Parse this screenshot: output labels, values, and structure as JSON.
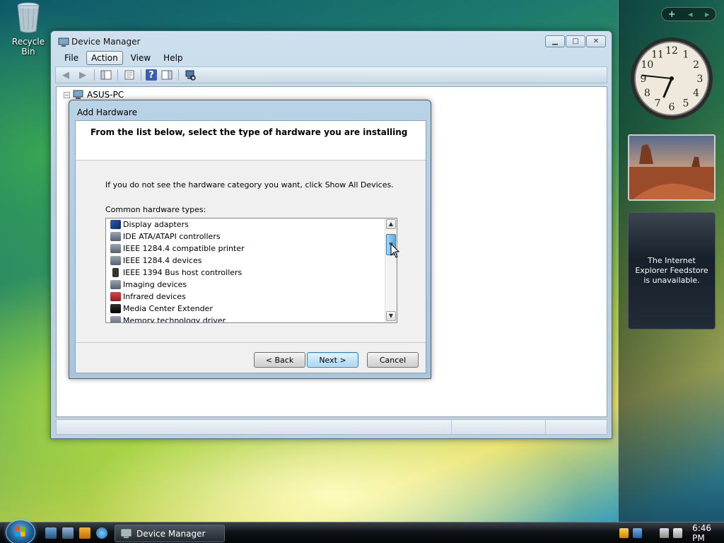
{
  "desktop": {
    "recycle_bin_label": "Recycle Bin"
  },
  "sidebar": {
    "add_symbol": "+",
    "prev_symbol": "◀",
    "next_symbol": "▶",
    "clock_numbers": [
      "12",
      "1",
      "2",
      "3",
      "4",
      "5",
      "6",
      "7",
      "8",
      "9",
      "10",
      "11"
    ],
    "clock_time": "6:46",
    "feed_message": "The Internet Explorer Feedstore is unavailable."
  },
  "window": {
    "title": "Device Manager",
    "minimize_symbol": "▁",
    "maximize_symbol": "□",
    "close_symbol": "✕",
    "menu": [
      "File",
      "Action",
      "View",
      "Help"
    ],
    "active_menu": "Action",
    "toolbar": {
      "back_icon": "◀",
      "forward_icon": "▶",
      "help_icon": "?"
    },
    "tree_root": "ASUS-PC",
    "tree_expander": "−"
  },
  "dialog": {
    "title": "Add Hardware",
    "heading": "From the list below, select the type of hardware you are installing",
    "info": "If you do not see the hardware category you want, click Show All Devices.",
    "list_label": "Common hardware types:",
    "items": [
      "Display adapters",
      "IDE ATA/ATAPI controllers",
      "IEEE 1284.4 compatible printer",
      "IEEE 1284.4 devices",
      "IEEE 1394 Bus host controllers",
      "Imaging devices",
      "Infrared devices",
      "Media Center Extender",
      "Memory technology driver"
    ],
    "scroll_up": "▲",
    "scroll_down": "▼",
    "scroll_grip": "≡",
    "back_button": "< Back",
    "next_button": "Next >",
    "cancel_button": "Cancel"
  },
  "taskbar": {
    "task_label": "Device Manager",
    "time": "6:46 PM"
  },
  "colors": {
    "accent": "#3c7fb1",
    "taskbar": "#0e1216"
  }
}
